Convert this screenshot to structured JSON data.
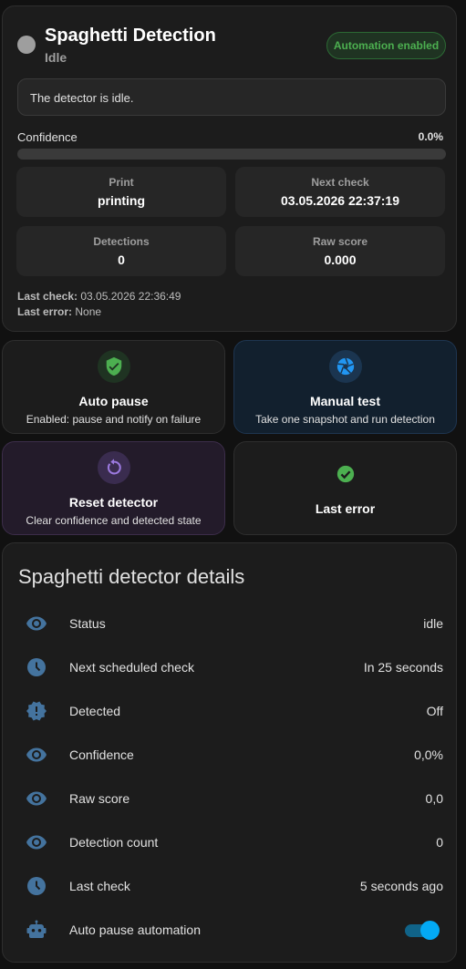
{
  "header": {
    "title": "Spaghetti Detection",
    "state": "Idle",
    "badge": "Automation enabled",
    "message": "The detector is idle."
  },
  "confidence": {
    "label": "Confidence",
    "value": "0.0%",
    "fraction": 0
  },
  "stats": [
    {
      "label": "Print",
      "value": "printing"
    },
    {
      "label": "Next check",
      "value": "03.05.2026 22:37:19"
    },
    {
      "label": "Detections",
      "value": "0"
    },
    {
      "label": "Raw score",
      "value": "0.000"
    }
  ],
  "meta": {
    "last_check_label": "Last check:",
    "last_check_value": "03.05.2026 22:36:49",
    "last_error_label": "Last error:",
    "last_error_value": "None"
  },
  "tiles": [
    {
      "name": "Auto pause",
      "secondary": "Enabled: pause and notify on failure",
      "icon": "shield-check-icon",
      "color": "#4caf50"
    },
    {
      "name": "Manual test",
      "secondary": "Take one snapshot and run detection",
      "icon": "camera-shutter-icon",
      "color": "#2196f3"
    },
    {
      "name": "Reset detector",
      "secondary": "Clear confidence and detected state",
      "icon": "restart-icon",
      "color": "#9c7ae0"
    },
    {
      "name": "Last error",
      "secondary": "",
      "icon": "check-circle-icon",
      "color": "#4caf50"
    }
  ],
  "details": {
    "title": "Spaghetti detector details",
    "icon_color": "#44739e",
    "rows": [
      {
        "label": "Status",
        "value": "idle",
        "icon": "eye-icon"
      },
      {
        "label": "Next scheduled check",
        "value": "In 25 seconds",
        "icon": "clock-icon"
      },
      {
        "label": "Detected",
        "value": "Off",
        "icon": "alert-decagram-icon"
      },
      {
        "label": "Confidence",
        "value": "0,0%",
        "icon": "eye-icon"
      },
      {
        "label": "Raw score",
        "value": "0,0",
        "icon": "eye-icon"
      },
      {
        "label": "Detection count",
        "value": "0",
        "icon": "eye-icon"
      },
      {
        "label": "Last check",
        "value": "5 seconds ago",
        "icon": "clock-icon"
      },
      {
        "label": "Auto pause automation",
        "value": "",
        "icon": "robot-icon",
        "toggle_on": true
      }
    ]
  }
}
